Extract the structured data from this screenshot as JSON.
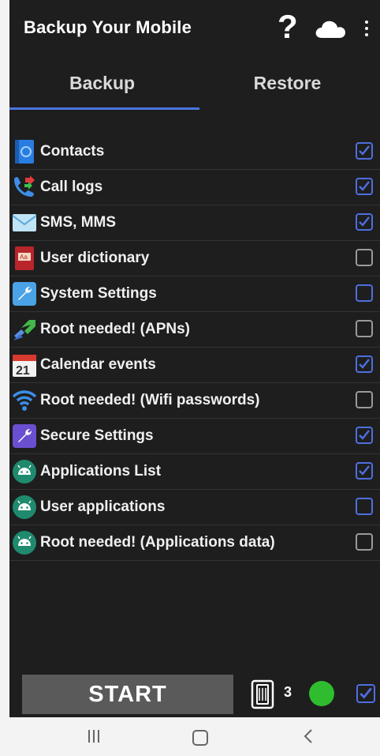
{
  "app": {
    "title": "Backup Your Mobile"
  },
  "toolbar": {
    "help_label": "?"
  },
  "tabs": [
    {
      "label": "Backup",
      "selected": true
    },
    {
      "label": "Restore",
      "selected": false
    }
  ],
  "items": [
    {
      "label": "Contacts",
      "icon": "contacts-icon",
      "checked": true
    },
    {
      "label": "Call logs",
      "icon": "call-logs-icon",
      "checked": true
    },
    {
      "label": "SMS, MMS",
      "icon": "sms-icon",
      "checked": true
    },
    {
      "label": "User dictionary",
      "icon": "dictionary-icon",
      "checked": false
    },
    {
      "label": "System Settings",
      "icon": "system-settings-icon",
      "checked": false
    },
    {
      "label": "Root needed! (APNs)",
      "icon": "apn-icon",
      "checked": false
    },
    {
      "label": "Calendar events",
      "icon": "calendar-icon",
      "checked": true,
      "icon_text": "21"
    },
    {
      "label": "Root needed! (Wifi passwords)",
      "icon": "wifi-icon",
      "checked": false
    },
    {
      "label": "Secure Settings",
      "icon": "secure-settings-icon",
      "checked": true
    },
    {
      "label": "Applications List",
      "icon": "android-icon",
      "checked": true
    },
    {
      "label": "User applications",
      "icon": "android-icon",
      "checked": false
    },
    {
      "label": "Root needed! (Applications data)",
      "icon": "android-icon",
      "checked": false
    }
  ],
  "bottom": {
    "start_label": "START",
    "storage_count": "3",
    "status_color": "#2fbd2f",
    "checked": true
  },
  "colors": {
    "accent": "#4a74e0",
    "background": "#1e1e1e"
  }
}
